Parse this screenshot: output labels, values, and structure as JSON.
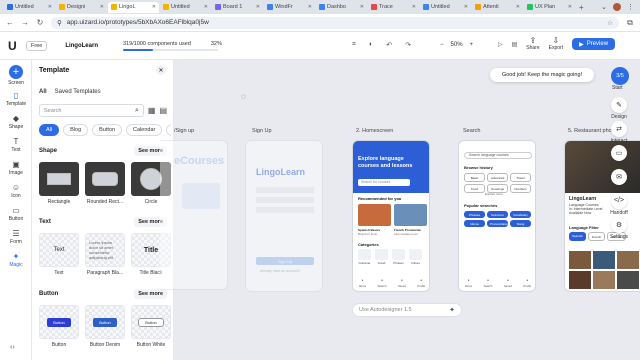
{
  "browser": {
    "tabs": [
      {
        "label": "Untitled",
        "color": "#2c6de6"
      },
      {
        "label": "Designi",
        "color": "#f4b400"
      },
      {
        "label": "LingoL",
        "color": "#f4b400",
        "active": true
      },
      {
        "label": "Untitled",
        "color": "#f4b400"
      },
      {
        "label": "Board 1",
        "color": "#7b61ff"
      },
      {
        "label": "WindFr",
        "color": "#3b82f6"
      },
      {
        "label": "Dashbo",
        "color": "#3b82f6"
      },
      {
        "label": "Trace",
        "color": "#ef4444"
      },
      {
        "label": "Untitled",
        "color": "#3b82f6"
      },
      {
        "label": "Attenti",
        "color": "#f59e0b"
      },
      {
        "label": "UX Plan",
        "color": "#22c55e"
      }
    ],
    "url": "app.uizard.io/prototypes/5bXbAXo6EAFlblqa0j5w"
  },
  "header": {
    "plan": "Free",
    "project_name": "LingoLearn",
    "usage_text": "319/1000 components used",
    "usage_percent_text": "32%",
    "usage_fraction": 0.32,
    "zoom": "50%",
    "share_label": "Share",
    "export_label": "Export",
    "preview_label": "Preview"
  },
  "rail": {
    "items": [
      {
        "name": "screen",
        "label": "Screen",
        "icon": "+"
      },
      {
        "name": "template",
        "label": "Template",
        "icon": "▯"
      },
      {
        "name": "shape",
        "label": "Shape",
        "icon": "◆"
      },
      {
        "name": "text",
        "label": "Text",
        "icon": "T"
      },
      {
        "name": "image",
        "label": "Image",
        "icon": "▣"
      },
      {
        "name": "icon",
        "label": "Icon",
        "icon": "☺"
      },
      {
        "name": "button",
        "label": "Button",
        "icon": "▭"
      },
      {
        "name": "form",
        "label": "Form",
        "icon": "☰"
      },
      {
        "name": "magic",
        "label": "Magic",
        "icon": "✦"
      }
    ]
  },
  "panel": {
    "title": "Template",
    "tab_all": "All",
    "tab_saved": "Saved Templates",
    "search_placeholder": "Search",
    "chips": [
      "All",
      "Blog",
      "Button",
      "Calendar",
      "Ca"
    ],
    "shape_section": "Shape",
    "text_section": "Text",
    "button_section": "Button",
    "see_more": "See more",
    "shape_tiles": [
      "Rectangle",
      "Rounded Rect...",
      "Circle"
    ],
    "text_tiles": [
      "Text",
      "Paragraph Bla...",
      "Title Black"
    ],
    "text_previews": {
      "text": "Text",
      "paragraph": "Lorem ipsum dolor sit amet consectetur adipiscing elit",
      "title": "Title"
    },
    "button_tiles": [
      "Button",
      "Button Denim",
      "Button White"
    ],
    "button_preview_label": "Button"
  },
  "canvas": {
    "screen_labels": [
      "/Sign up",
      "Sign Up",
      "2. Homescreen",
      "Search",
      "5. Restaurant photo"
    ],
    "toast": "Good job! Keep the magic going!",
    "step": "3/5",
    "start_label": "Start",
    "ai_bar": "Use Autodesigner 1.5",
    "right_tools": [
      "Design",
      "Interact",
      "Screens",
      "Comments",
      "Handoff",
      "Settings"
    ],
    "home": {
      "hero_title": "Explore language courses and lessons",
      "search_placeholder": "Search for courses",
      "recommended": "Recommended for you",
      "card1_title": "Spanish Basics",
      "card1_sub": "Beginner level",
      "card2_title": "French Pronunciat.",
      "card2_sub": "Intermediate level",
      "categories": "Categories",
      "cats": [
        "Grammar",
        "Vocab",
        "Phrases",
        "Culture"
      ],
      "nav": [
        "Home",
        "Search",
        "Saved",
        "Profile"
      ]
    },
    "search": {
      "placeholder": "Search language courses",
      "history_title": "Browse history",
      "history_chips": [
        "Basic",
        "Advanced",
        "Travel",
        "Food",
        "Greetings",
        "Numbers"
      ],
      "explore_more": "Explore more",
      "popular_title": "Popular searches",
      "popular_chips": [
        "Phrases",
        "Grammar",
        "Vocabulary",
        "Idioms",
        "Pronunciation",
        "Slang"
      ],
      "nav": [
        "Home",
        "Search",
        "Saved",
        "Profile"
      ]
    },
    "signup_left": {
      "heading": "eCourses"
    },
    "signup": {
      "brand": "LingoLearn",
      "button": "Sign Up",
      "link": "Already have an account?"
    },
    "restaurant": {
      "title": "LingoLearn",
      "line1": "Language Courses",
      "line2": "in: Intermediate Level",
      "line3": "Available Now",
      "filter": "Language Filter",
      "filters": [
        "Spanish",
        "French",
        "German"
      ]
    }
  },
  "colors": {
    "accent": "#2c6de6",
    "hero": "#2c5fd6"
  }
}
